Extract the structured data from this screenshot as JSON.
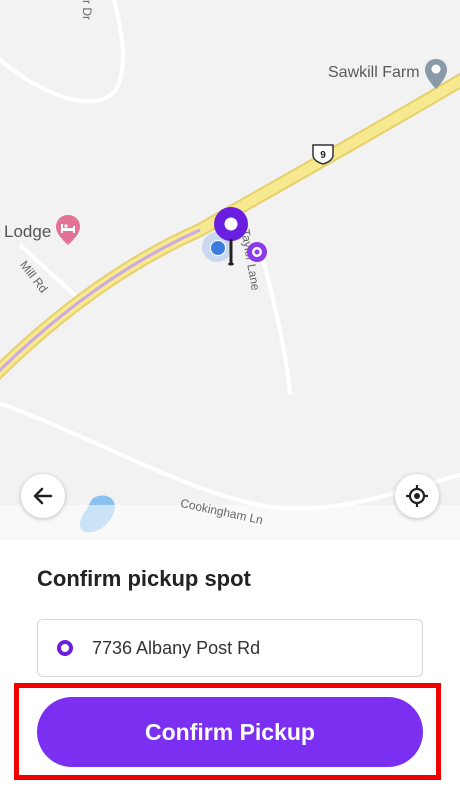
{
  "map": {
    "labels": {
      "sawkill_farm": "Sawkill Farm",
      "lodge": "Lodge",
      "mill_rd": "Mill Rd",
      "taylor_lane": "Taylor Lane",
      "cookingham_ln": "Cookingham Ln",
      "top_road": "r Dr",
      "route_number": "9"
    },
    "icons": {
      "back": "arrow-left-icon",
      "locate": "crosshair-location-icon",
      "poi": "map-pin-icon",
      "lodging": "bed-icon"
    },
    "colors": {
      "highway": "#f3e27e",
      "pin": "#6a1ee0",
      "user_location": "#3d7be0",
      "water": "#8cc0ee",
      "lodging_pin": "#e27395",
      "poi_pin": "#8a9aa8"
    }
  },
  "sheet": {
    "title": "Confirm pickup spot",
    "address": "7736 Albany Post Rd",
    "confirm_label": "Confirm Pickup"
  },
  "colors": {
    "accent": "#7b2ff0",
    "highlight": "#f10000"
  }
}
